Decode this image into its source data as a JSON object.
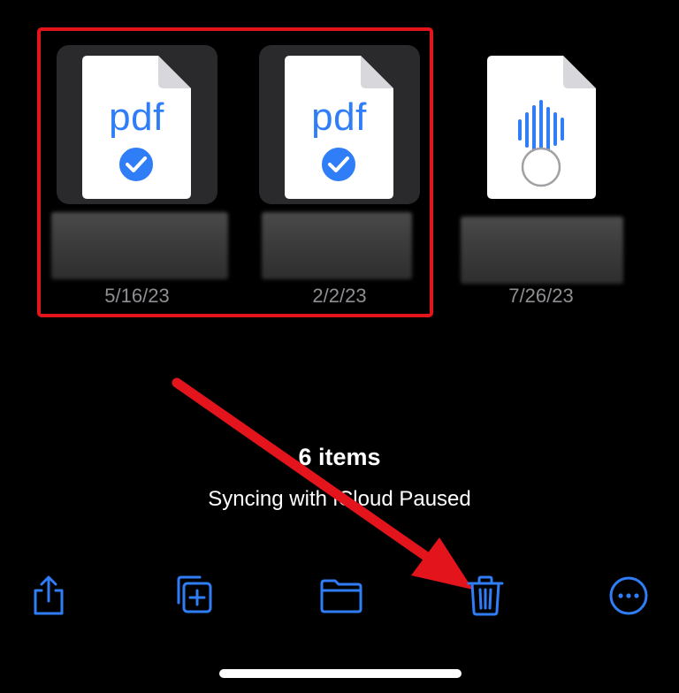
{
  "files": [
    {
      "kind": "pdf",
      "label": "pdf",
      "date": "5/16/23",
      "selected": true,
      "name": ""
    },
    {
      "kind": "pdf",
      "label": "pdf",
      "date": "2/2/23",
      "selected": true,
      "name": ""
    },
    {
      "kind": "audio",
      "label": "",
      "date": "7/26/23",
      "selected": false,
      "name": ""
    }
  ],
  "status": {
    "count": "6 items",
    "sync": "Syncing with iCloud Paused"
  },
  "toolbar": {
    "share_icon": "share-icon",
    "duplicate_icon": "duplicate-icon",
    "move_icon": "folder-icon",
    "delete_icon": "trash-icon",
    "more_icon": "more-icon"
  },
  "colors": {
    "accent": "#2f7ef7",
    "highlight": "#e4141c",
    "background": "#000000"
  }
}
